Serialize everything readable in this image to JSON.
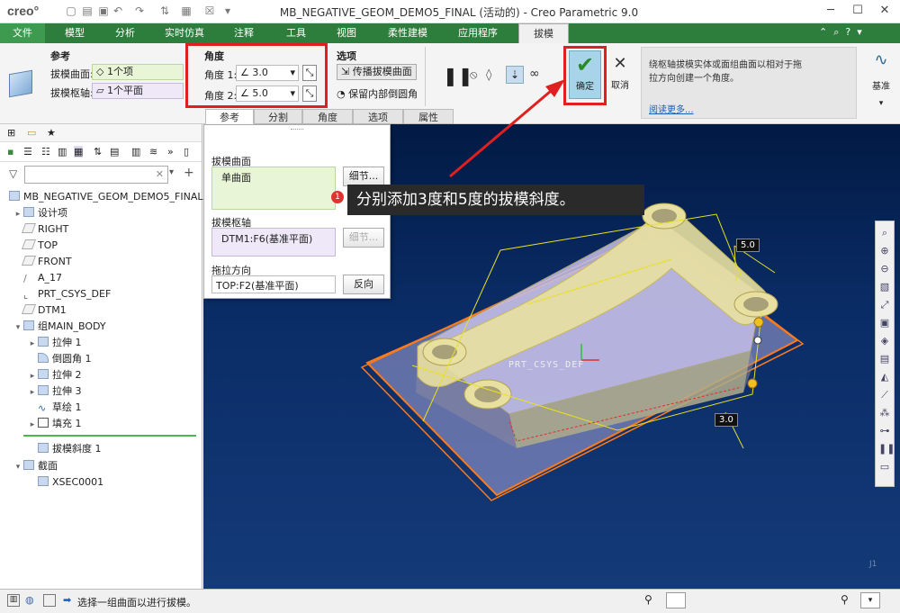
{
  "app": {
    "logo": "creo°",
    "window_title": "MB_NEGATIVE_GEOM_DEMO5_FINAL (活动的) - Creo Parametric 9.0"
  },
  "ribbon_tabs": [
    "文件",
    "模型",
    "分析",
    "实时仿真",
    "注释",
    "工具",
    "视图",
    "柔性建模",
    "应用程序",
    "拔模"
  ],
  "ribbon": {
    "references": {
      "title": "参考",
      "surface_label": "拔模曲面:",
      "surface_value": "1个项",
      "axis_label": "拔模枢轴:",
      "axis_value": "1个平面"
    },
    "angle": {
      "title": "角度",
      "angle1_label": "角度 1:",
      "angle1_value": "3.0",
      "angle2_label": "角度 2:",
      "angle2_value": "5.0"
    },
    "options": {
      "title": "选项",
      "propagate": "传播拔模曲面",
      "keep_rounds": "保留内部倒圆角"
    },
    "confirm": "确定",
    "cancel": "取消",
    "description": "绕枢轴拔模实体或面组曲面以相对于拖拉方向创建一个角度。",
    "read_more": "阅读更多...",
    "datum_label": "基准",
    "subtabs": [
      "参考",
      "分割",
      "角度",
      "选项",
      "属性"
    ]
  },
  "popup": {
    "surface_title": "拔模曲面",
    "surface_value": "单曲面",
    "details_button": "细节...",
    "hinge_title": "拔模枢轴",
    "hinge_value": "DTM1:F6(基准平面)",
    "details_button2": "细节...",
    "direction_title": "拖拉方向",
    "direction_value": "TOP:F2(基准平面)",
    "flip_button": "反向"
  },
  "model_tree": {
    "root": "MB_NEGATIVE_GEOM_DEMO5_FINAL.PR",
    "items": [
      {
        "label": "设计项",
        "icon": "folder"
      },
      {
        "label": "RIGHT",
        "icon": "plane"
      },
      {
        "label": "TOP",
        "icon": "plane"
      },
      {
        "label": "FRONT",
        "icon": "plane"
      },
      {
        "label": "A_17",
        "icon": "axis"
      },
      {
        "label": "PRT_CSYS_DEF",
        "icon": "csys"
      },
      {
        "label": "DTM1",
        "icon": "plane"
      },
      {
        "label": "组MAIN_BODY",
        "icon": "group"
      },
      {
        "label": "拉伸 1",
        "icon": "extrude"
      },
      {
        "label": "倒圆角 1",
        "icon": "round"
      },
      {
        "label": "拉伸 2",
        "icon": "extrude"
      },
      {
        "label": "拉伸 3",
        "icon": "extrude"
      },
      {
        "label": "草绘 1",
        "icon": "sketch"
      },
      {
        "label": "填充 1",
        "icon": "fill"
      },
      {
        "label": "拔模斜度 1",
        "icon": "draft"
      },
      {
        "label": "截面",
        "icon": "section"
      },
      {
        "label": "XSEC0001",
        "icon": "xsec"
      }
    ]
  },
  "viewport": {
    "csys_label": "PRT_CSYS_DEF",
    "angle_tag_1": "5.0",
    "angle_tag_2": "3.0",
    "watermark": "J1"
  },
  "callout": {
    "number": "1",
    "text": "分别添加3度和5度的拔模斜度。"
  },
  "status": {
    "message": "选择一组曲面以进行拔模。"
  }
}
